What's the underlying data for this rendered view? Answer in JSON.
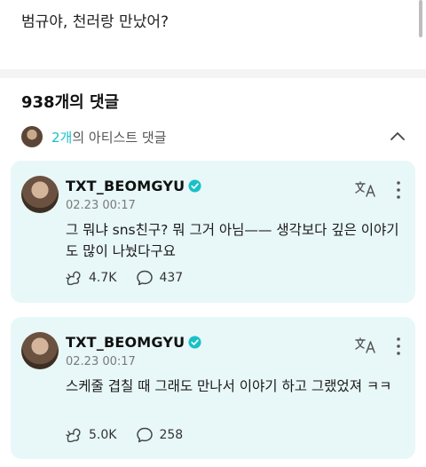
{
  "post": {
    "text": "범규야, 천러랑 만났어?"
  },
  "comments_header": {
    "title": "938개의 댓글"
  },
  "artist_comments": {
    "count": "2개",
    "label": "의 아티스트 댓글"
  },
  "comments": [
    {
      "username": "TXT_BEOMGYU",
      "timestamp": "02.23 00:17",
      "text": "그 뭐냐 sns친구? 뭐 그거 아님—— 생각보다 깊은 이야기도 많이 나눴다구요",
      "likes": "4.7K",
      "replies": "437"
    },
    {
      "username": "TXT_BEOMGYU",
      "timestamp": "02.23 00:17",
      "text": "스케줄 겹칠 때 그래도 만나서 이야기 하고 그랬었져 ㅋㅋ",
      "likes": "5.0K",
      "replies": "258"
    }
  ],
  "colors": {
    "accent": "#19c0c9",
    "card_bg": "#e8f7f7"
  },
  "icons": [
    "chevron-up-icon",
    "verified-icon",
    "translate-icon",
    "more-vertical-icon",
    "like-icon",
    "reply-icon"
  ]
}
